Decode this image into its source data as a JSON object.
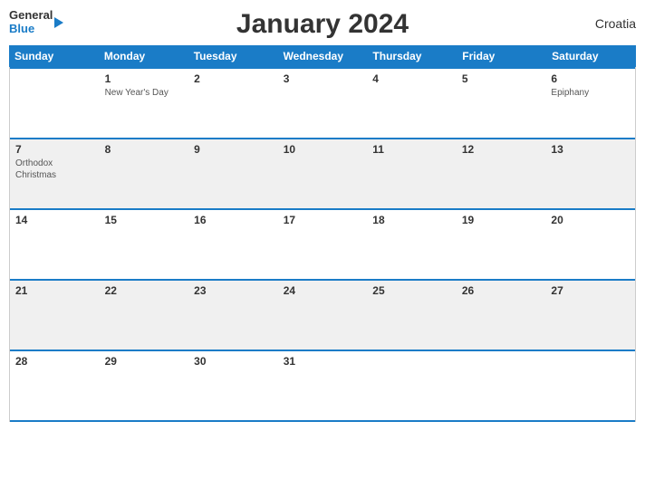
{
  "header": {
    "title": "January 2024",
    "country": "Croatia",
    "logo_general": "General",
    "logo_blue": "Blue"
  },
  "days_of_week": [
    "Sunday",
    "Monday",
    "Tuesday",
    "Wednesday",
    "Thursday",
    "Friday",
    "Saturday"
  ],
  "weeks": [
    {
      "row": 1,
      "days": [
        {
          "date": "",
          "holiday": ""
        },
        {
          "date": "1",
          "holiday": "New Year's Day"
        },
        {
          "date": "2",
          "holiday": ""
        },
        {
          "date": "3",
          "holiday": ""
        },
        {
          "date": "4",
          "holiday": ""
        },
        {
          "date": "5",
          "holiday": ""
        },
        {
          "date": "6",
          "holiday": "Epiphany"
        }
      ]
    },
    {
      "row": 2,
      "days": [
        {
          "date": "7",
          "holiday": "Orthodox Christmas"
        },
        {
          "date": "8",
          "holiday": ""
        },
        {
          "date": "9",
          "holiday": ""
        },
        {
          "date": "10",
          "holiday": ""
        },
        {
          "date": "11",
          "holiday": ""
        },
        {
          "date": "12",
          "holiday": ""
        },
        {
          "date": "13",
          "holiday": ""
        }
      ]
    },
    {
      "row": 3,
      "days": [
        {
          "date": "14",
          "holiday": ""
        },
        {
          "date": "15",
          "holiday": ""
        },
        {
          "date": "16",
          "holiday": ""
        },
        {
          "date": "17",
          "holiday": ""
        },
        {
          "date": "18",
          "holiday": ""
        },
        {
          "date": "19",
          "holiday": ""
        },
        {
          "date": "20",
          "holiday": ""
        }
      ]
    },
    {
      "row": 4,
      "days": [
        {
          "date": "21",
          "holiday": ""
        },
        {
          "date": "22",
          "holiday": ""
        },
        {
          "date": "23",
          "holiday": ""
        },
        {
          "date": "24",
          "holiday": ""
        },
        {
          "date": "25",
          "holiday": ""
        },
        {
          "date": "26",
          "holiday": ""
        },
        {
          "date": "27",
          "holiday": ""
        }
      ]
    },
    {
      "row": 5,
      "days": [
        {
          "date": "28",
          "holiday": ""
        },
        {
          "date": "29",
          "holiday": ""
        },
        {
          "date": "30",
          "holiday": ""
        },
        {
          "date": "31",
          "holiday": ""
        },
        {
          "date": "",
          "holiday": ""
        },
        {
          "date": "",
          "holiday": ""
        },
        {
          "date": "",
          "holiday": ""
        }
      ]
    }
  ],
  "colors": {
    "header_bg": "#1a7cc7",
    "separator": "#1a7cc7",
    "odd_row_bg": "#f0f0f0",
    "even_row_bg": "#ffffff"
  }
}
